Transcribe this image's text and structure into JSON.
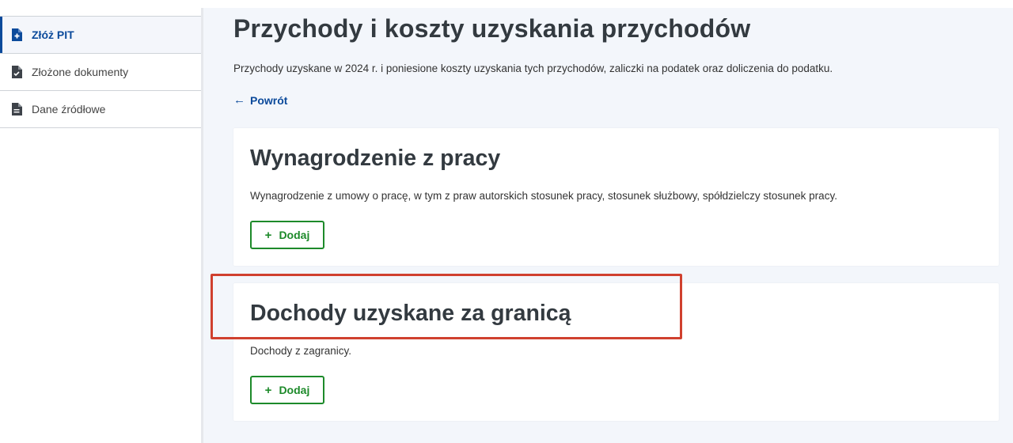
{
  "sidebar": {
    "items": [
      {
        "label": "Złóż PIT",
        "icon": "file-add-icon",
        "active": true
      },
      {
        "label": "Złożone dokumenty",
        "icon": "file-check-icon",
        "active": false
      },
      {
        "label": "Dane źródłowe",
        "icon": "file-text-icon",
        "active": false
      }
    ]
  },
  "main": {
    "title": "Przychody i koszty uzyskania przychodów",
    "description": "Przychody uzyskane w 2024 r. i poniesione koszty uzyskania tych przychodów, zaliczki na podatek oraz doliczenia do podatku.",
    "back_label": "Powrót",
    "cards": [
      {
        "title": "Wynagrodzenie z pracy",
        "description": "Wynagrodzenie z umowy o pracę, w tym z praw autorskich stosunek pracy, stosunek służbowy, spółdzielczy stosunek pracy.",
        "button_label": "Dodaj"
      },
      {
        "title": "Dochody uzyskane za granicą",
        "description": "Dochody z zagranicy.",
        "button_label": "Dodaj"
      }
    ]
  },
  "colors": {
    "accent": "#0b4a9b",
    "button_green": "#1d8a2a",
    "highlight": "#d0402e",
    "background": "#f3f6fb"
  }
}
